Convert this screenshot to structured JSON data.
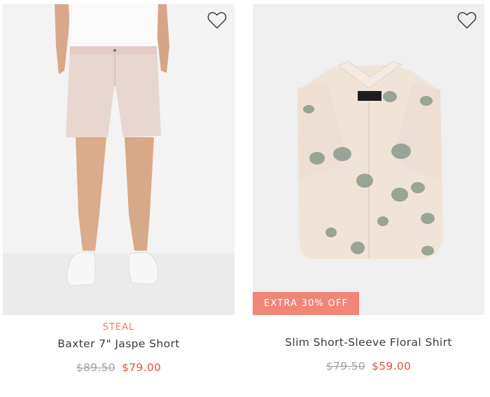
{
  "products": [
    {
      "tag": "STEAL",
      "name": "Baxter 7\" Jaspe Short",
      "original_price": "$89.50",
      "sale_price": "$79.00",
      "image_icon": "shorts-on-model-image",
      "wishlist_icon": "heart-outline-icon"
    },
    {
      "badge": "EXTRA 30% OFF",
      "name": "Slim Short-Sleeve Floral Shirt",
      "original_price": "$79.50",
      "sale_price": "$59.00",
      "image_icon": "floral-shirt-image",
      "wishlist_icon": "heart-outline-icon"
    }
  ],
  "colors": {
    "badge_bg": "#f08678",
    "tag": "#ee7b66",
    "sale_price": "#e2543d",
    "original_price": "#a2a2a2"
  }
}
